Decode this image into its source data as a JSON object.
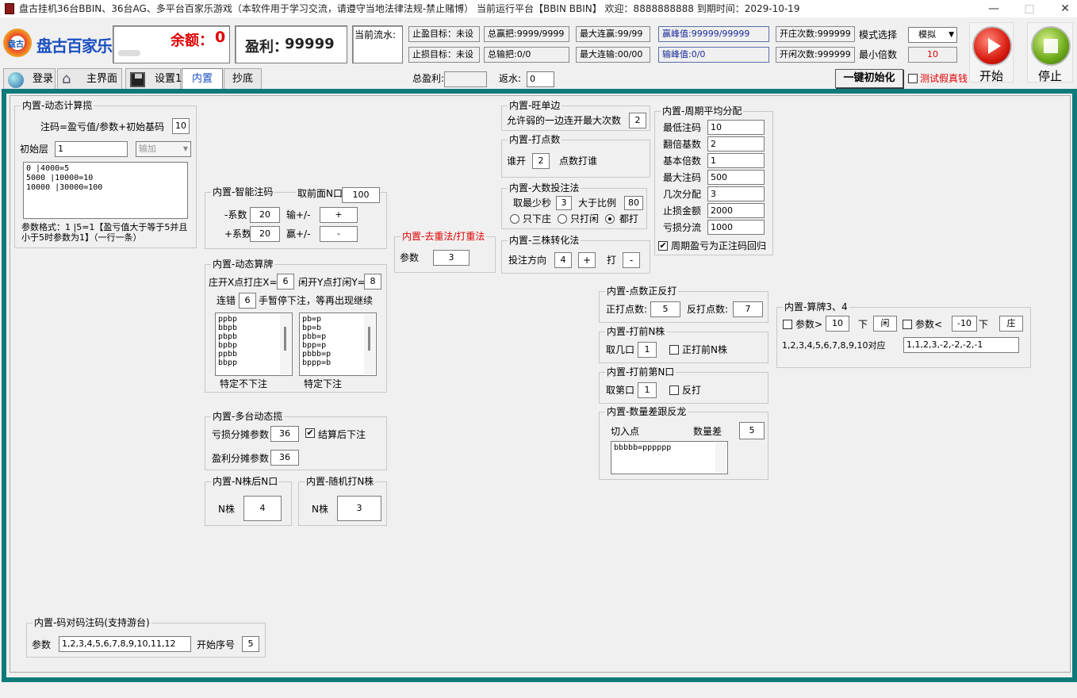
{
  "titlebar": {
    "text": "盘古挂机36台BBIN、36台AG、多平台百家乐游戏（本软件用于学习交流，请遵守当地法律法规-禁止赌博）  当前运行平台【BBIN BBIN】 欢迎：8888888888  到期时间：2029-10-19",
    "min": "—",
    "max": "□",
    "close": "✕"
  },
  "header": {
    "logo_text": "盘古百家乐",
    "logo_badge": "盘古",
    "balance_label": "余额：",
    "balance_value": "0",
    "profit_label": "盈利：",
    "profit_value": "99999",
    "current_flow_label": "当前流水:",
    "stop_win": "止盈目标：未设",
    "stop_loss": "止损目标：未设",
    "total_win": "总赢把:9999/9999",
    "total_lose": "总输把:0/0",
    "max_win_streak": "最大连赢:99/99",
    "max_lose_streak": "最大连输:00/00",
    "win_peak": "赢峰值:99999/99999",
    "lose_peak": "输峰值:0/0",
    "banker_count": "开庄次数:999999",
    "player_count": "开闲次数:999999",
    "mode_label": "模式选择",
    "mode_value": "模拟",
    "min_multiple_label": "最小倍数",
    "min_multiple_value": "10",
    "total_profit_label": "总盈利:",
    "rebate_label": "返水:",
    "rebate_value": "0",
    "init_button": "一键初始化",
    "test_fake_label": "测试假真钱",
    "start_label": "开始",
    "stop_label": "停止"
  },
  "tabs": {
    "login": "登录",
    "main": "主界面",
    "settings": "设置1",
    "builtin": "内置",
    "copy": "抄底"
  },
  "g_dynamic": {
    "title": "内置-动态计算揽",
    "formula": "注码=盈亏值/参数+初始基码",
    "formula_value": "10",
    "init_layer_label": "初始层",
    "init_layer_value": "1",
    "mode_value": "输加",
    "text": "0 |4000=5\n5000 |10000=10\n10000 |30000=100",
    "note": "参数格式：1 |5=1【盈亏值大于等于5并且小于5时参数为1】（一行一条）"
  },
  "g_smart": {
    "title": "内置-智能注码",
    "prev_label": "取前面N口",
    "prev_value": "100",
    "neg_label": "-系数",
    "neg_value": "20",
    "lose_label": "输+/-",
    "lose_value": "+",
    "pos_label": "+系数",
    "pos_value": "20",
    "win_label": "赢+/-",
    "win_value": "-"
  },
  "g_dyncalc": {
    "title": "内置-动态算牌",
    "b_label": "庄开X点打庄X=",
    "b_value": "6",
    "p_label": "闲开Y点打闲Y=",
    "p_value": "8",
    "err_label": "连错",
    "err_value": "6",
    "err_suffix": "手暂停下注，等再出现继续",
    "list1": "ppbp\nbbpb\npbpb\nbpbp\nppbb\nbbpp",
    "list2": "pb=p\nbp=b\npbb=p\nbpp=p\npbbb=p\nbppp=b",
    "cap1": "特定不下注",
    "cap2": "特定下注"
  },
  "g_multi": {
    "title": "内置-多台动态揽",
    "loss_label": "亏损分摊参数",
    "loss_value": "36",
    "settle_label": "结算后下注",
    "profit_label": "盈利分摊参数",
    "profit_value": "36"
  },
  "g_nzhu": {
    "title": "内置-N株后N口",
    "label": "N株",
    "value": "4"
  },
  "g_rand": {
    "title": "内置-随机打N株",
    "label": "N株",
    "value": "3"
  },
  "g_dedup": {
    "title": "内置-去重法/打重法",
    "label": "参数",
    "value": "3"
  },
  "g_wang": {
    "title": "内置-旺单边",
    "label": "允许弱的一边连开最大次数",
    "value": "2"
  },
  "g_point": {
    "title": "内置-打点数",
    "label": "谁开",
    "value": "2",
    "suffix": "点数打谁"
  },
  "g_big": {
    "title": "内置-大数投注法",
    "min_label": "取最少秒",
    "min_value": "3",
    "ratio_label": "大于比例",
    "ratio_value": "80",
    "r1": "只下庄",
    "r2": "只打闲",
    "r3": "都打"
  },
  "g_three": {
    "title": "内置-三株转化法",
    "dir_label": "投注方向",
    "dir_value": "4",
    "dir_sign": "+",
    "hit_label": "打",
    "hit_sign": "-"
  },
  "g_cycle": {
    "title": "内置-周期平均分配",
    "rows": [
      {
        "label": "最低注码",
        "value": "10"
      },
      {
        "label": "翻倍基数",
        "value": "2"
      },
      {
        "label": "基本倍数",
        "value": "1"
      },
      {
        "label": "最大注码",
        "value": "500"
      },
      {
        "label": "几次分配",
        "value": "3"
      },
      {
        "label": "止损金额",
        "value": "2000"
      },
      {
        "label": "亏损分流",
        "value": "1000"
      }
    ],
    "check_label": "周期盈亏为正注码回归"
  },
  "g_pointrev": {
    "title": "内置-点数正反打",
    "pos_label": "正打点数:",
    "pos_value": "5",
    "neg_label": "反打点数:",
    "neg_value": "7"
  },
  "g_prevn": {
    "title": "内置-打前N株",
    "label": "取几口",
    "value": "1",
    "check": "正打前N株"
  },
  "g_prevnth": {
    "title": "内置-打前第N口",
    "label": "取第口",
    "value": "1",
    "check": "反打"
  },
  "g_diff": {
    "title": "内置-数量差跟反龙",
    "entry_label": "切入点",
    "diff_label": "数量差",
    "diff_value": "5",
    "text": "bbbbb=pppppp"
  },
  "g_algo": {
    "title": "内置-算牌3、4",
    "p1_label": "参数>",
    "p1_value": "10",
    "down": "下",
    "p1_side": "闲",
    "p2_label": "参数<",
    "p2_value": "-10",
    "down2": "下",
    "p2_side": "庄",
    "map_label": "1,2,3,4,5,6,7,8,9,10对应",
    "map_value": "1,1,2,3,-2,-2,-2,-1"
  },
  "g_pair": {
    "title": "内置-码对码注码(支持游台)",
    "label": "参数",
    "value": "1,2,3,4,5,6,7,8,9,10,11,12",
    "seq_label": "开始序号",
    "seq_value": "5"
  },
  "colors": {
    "teal": "#0f7a7a",
    "red": "#e00000",
    "blue_text": "#1a2a9a"
  }
}
